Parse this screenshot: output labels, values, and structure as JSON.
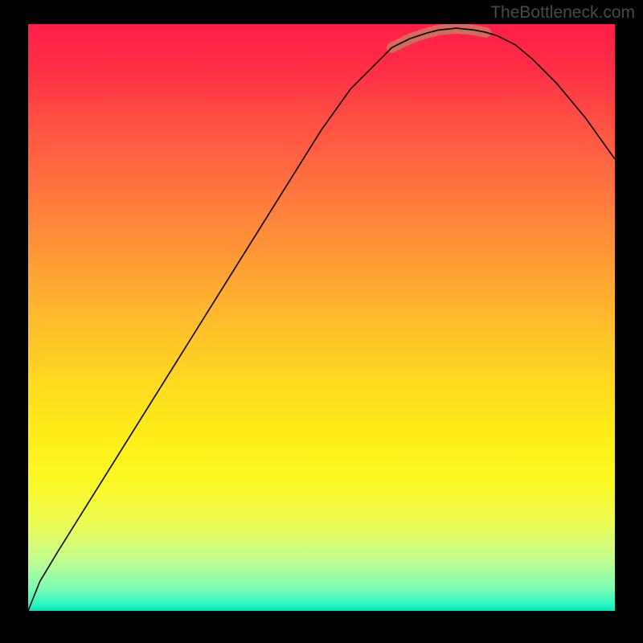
{
  "watermark": "TheBottleneck.com",
  "chart_data": {
    "type": "line",
    "title": "",
    "xlabel": "",
    "ylabel": "",
    "x": [
      0,
      2,
      5,
      10,
      15,
      20,
      25,
      30,
      35,
      40,
      45,
      50,
      55,
      60,
      62,
      65,
      68,
      70,
      73,
      76,
      78,
      80,
      83,
      86,
      90,
      95,
      100
    ],
    "values": [
      0,
      5,
      10,
      18,
      26,
      34,
      42,
      50,
      58,
      66,
      74,
      82,
      89,
      94,
      96,
      97.5,
      98.5,
      99,
      99.3,
      99,
      98.6,
      98,
      96.5,
      94,
      90,
      84,
      77
    ],
    "xlim": [
      0,
      100
    ],
    "ylim": [
      0,
      100
    ],
    "background_gradient": {
      "top": "#ff1e46",
      "middle": "#ffd91f",
      "bottom": "#00e8bf"
    },
    "highlight_segment_x": [
      62,
      78
    ],
    "highlight_color": "#d36a5e"
  }
}
